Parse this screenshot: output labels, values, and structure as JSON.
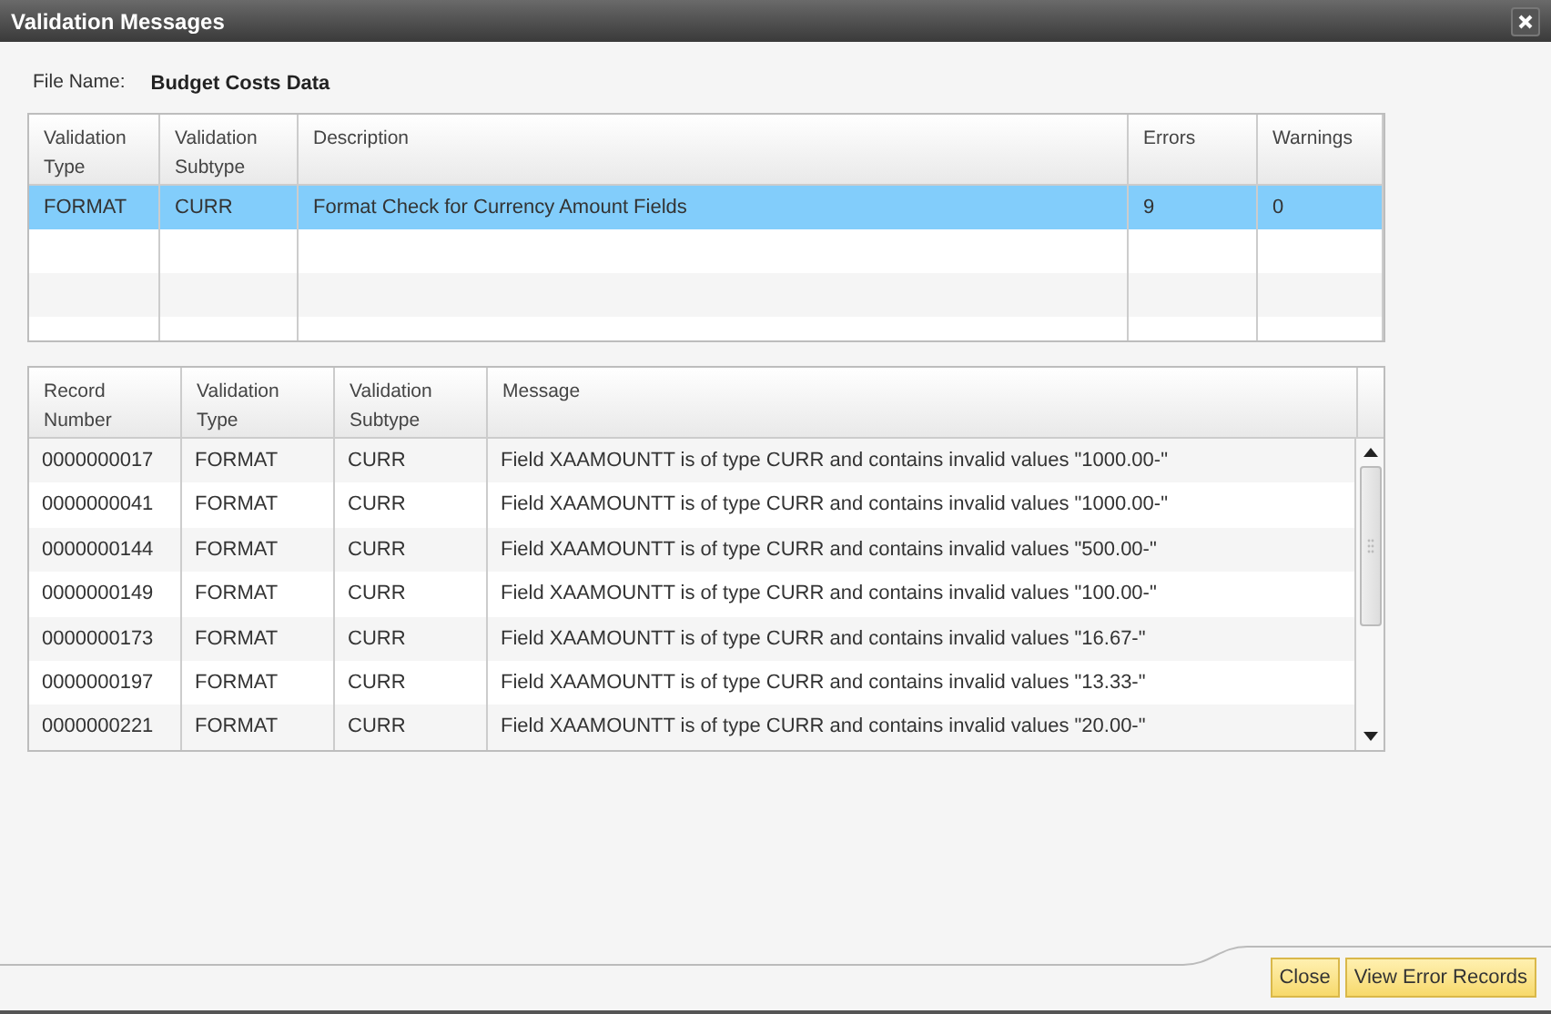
{
  "window": {
    "title": "Validation Messages"
  },
  "file_name": {
    "label": "File Name:",
    "value": "Budget Costs Data"
  },
  "summary_table": {
    "columns": [
      "Validation Type",
      "Validation Subtype",
      "Description",
      "Errors",
      "Warnings"
    ],
    "rows": [
      {
        "cells": [
          "FORMAT",
          "CURR",
          "Format Check for Currency Amount Fields",
          "9",
          "0"
        ],
        "selected": true
      }
    ]
  },
  "message_table": {
    "columns": [
      "Record Number",
      "Validation Type",
      "Validation Subtype",
      "Message"
    ],
    "rows": [
      {
        "cells": [
          "0000000017",
          "FORMAT",
          "CURR",
          "Field XAAMOUNTT is of type CURR and contains invalid values \"1000.00-\""
        ]
      },
      {
        "cells": [
          "0000000041",
          "FORMAT",
          "CURR",
          "Field XAAMOUNTT is of type CURR and contains invalid values \"1000.00-\""
        ]
      },
      {
        "cells": [
          "0000000144",
          "FORMAT",
          "CURR",
          "Field XAAMOUNTT is of type CURR and contains invalid values \"500.00-\""
        ]
      },
      {
        "cells": [
          "0000000149",
          "FORMAT",
          "CURR",
          "Field XAAMOUNTT is of type CURR and contains invalid values \"100.00-\""
        ]
      },
      {
        "cells": [
          "0000000173",
          "FORMAT",
          "CURR",
          "Field XAAMOUNTT is of type CURR and contains invalid values \"16.67-\""
        ]
      },
      {
        "cells": [
          "0000000197",
          "FORMAT",
          "CURR",
          "Field XAAMOUNTT is of type CURR and contains invalid values \"13.33-\""
        ]
      },
      {
        "cells": [
          "0000000221",
          "FORMAT",
          "CURR",
          "Field XAAMOUNTT is of type CURR and contains invalid values \"20.00-\""
        ]
      }
    ]
  },
  "buttons": [
    "Close",
    "View Error Records"
  ]
}
